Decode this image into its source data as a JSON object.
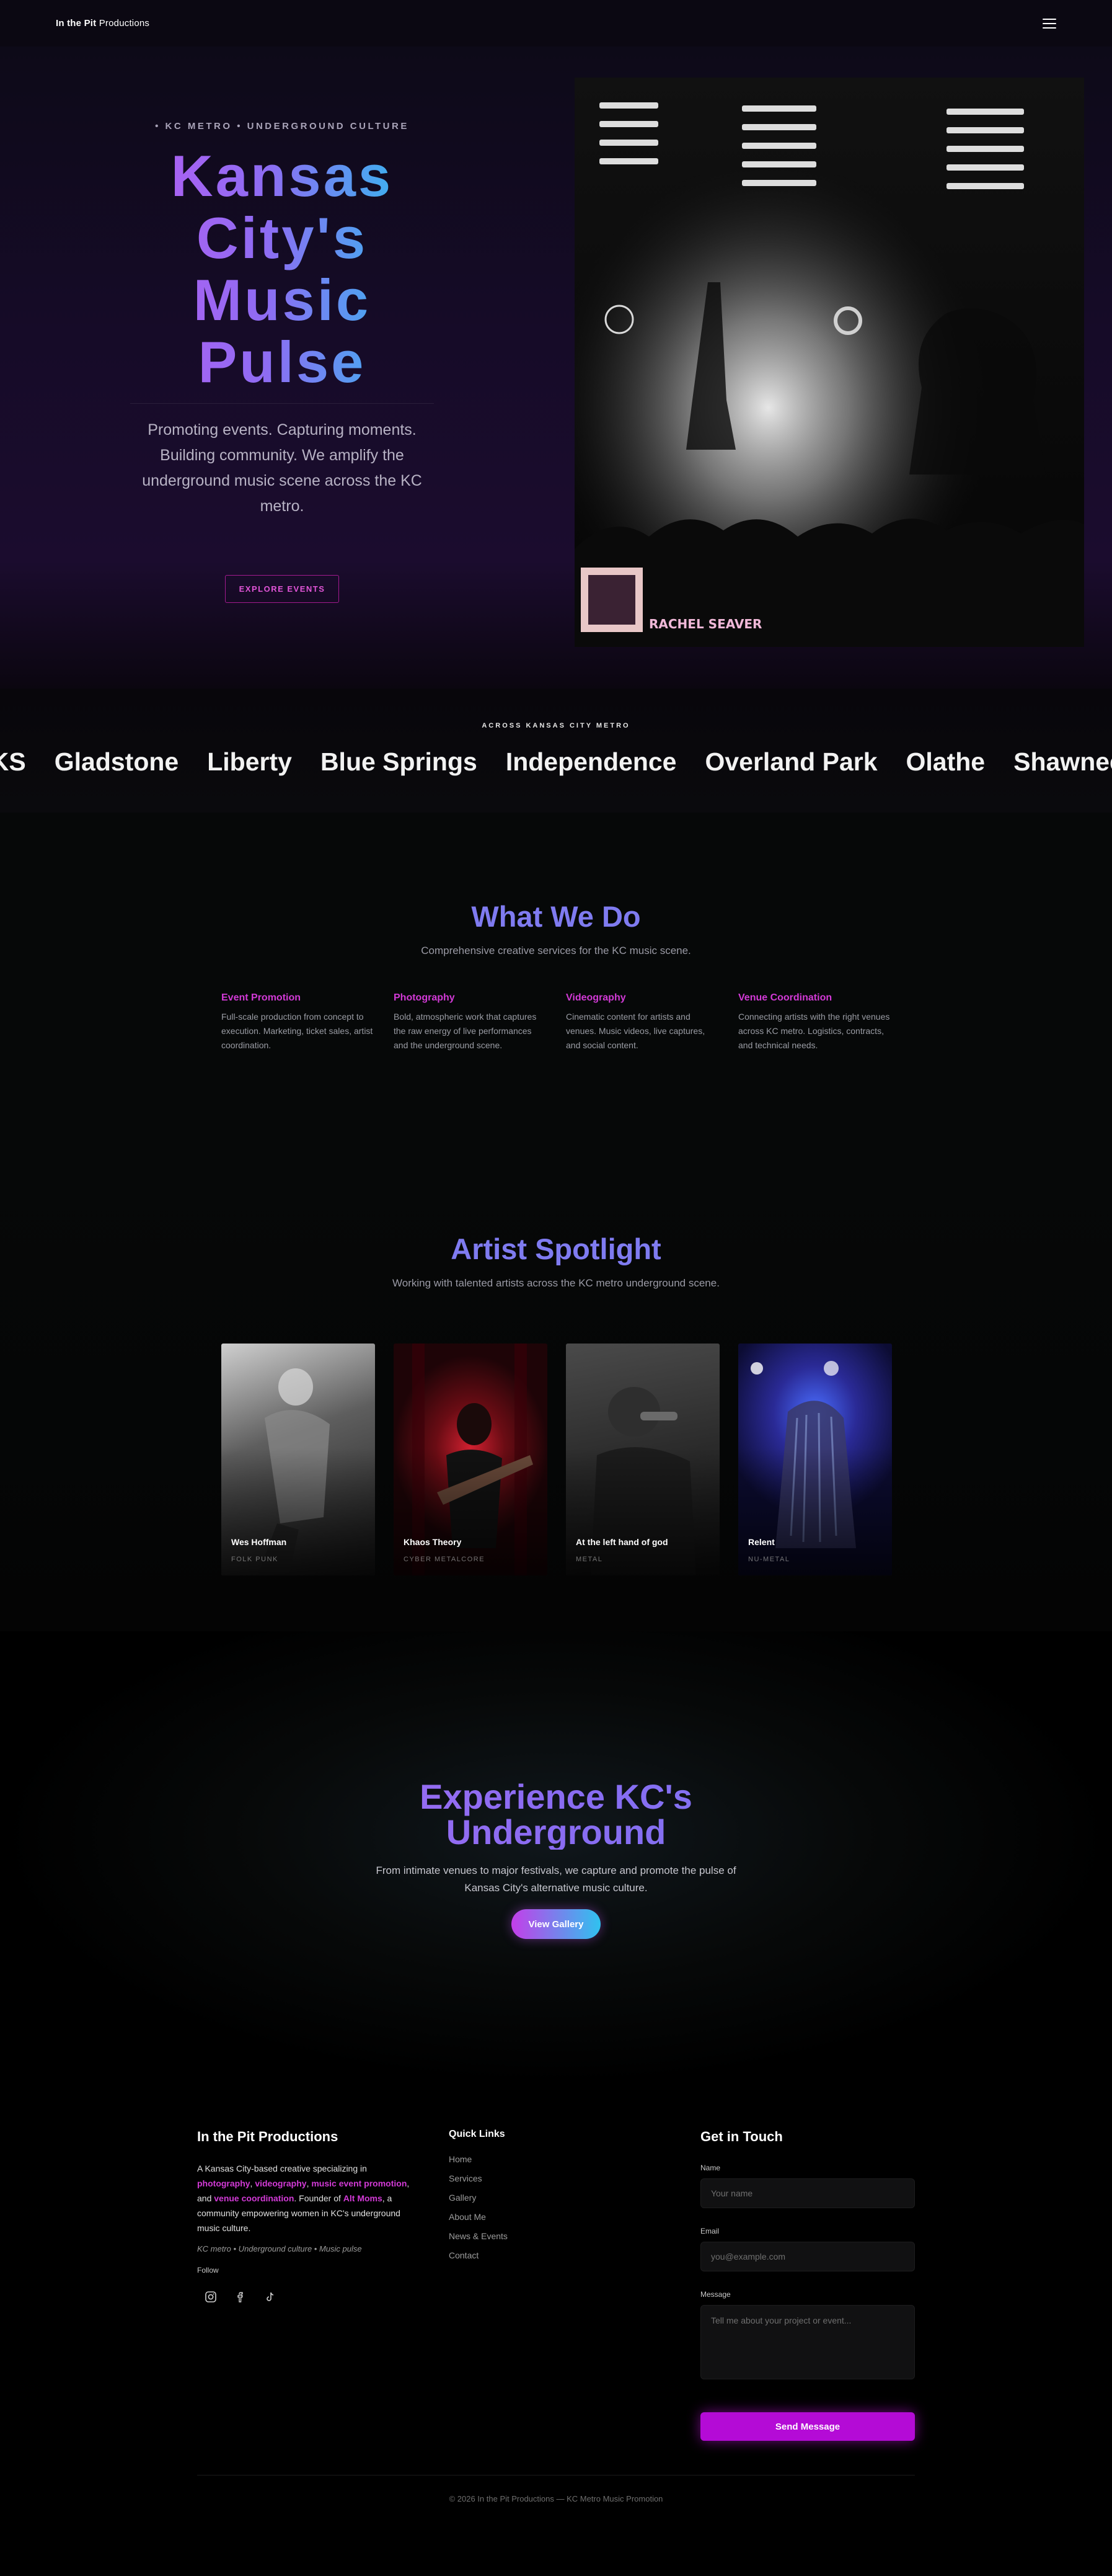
{
  "nav": {
    "brand_bold": "In the Pit",
    "brand_light": " Productions"
  },
  "hero": {
    "eyebrow": "• KC METRO • UNDERGROUND CULTURE",
    "title_lines": [
      "Kansas",
      "City's",
      "Music",
      "Pulse"
    ],
    "subtitle": "Promoting events. Capturing moments. Building community. We amplify the underground music scene across the KC metro.",
    "cta": "EXPLORE EVENTS",
    "photo_credit": "RACHEL SEAVER"
  },
  "cities": {
    "label": "ACROSS KANSAS CITY METRO",
    "items": [
      ", KS",
      "Gladstone",
      "Liberty",
      "Blue Springs",
      "Independence",
      "Overland Park",
      "Olathe",
      "Shawnee"
    ]
  },
  "services": {
    "title": "What We Do",
    "subtitle": "Comprehensive creative services for the KC music scene.",
    "items": [
      {
        "title": "Event Promotion",
        "text": "Full-scale production from concept to execution. Marketing, ticket sales, artist coordination."
      },
      {
        "title": "Photography",
        "text": "Bold, atmospheric work that captures the raw energy of live performances and the underground scene."
      },
      {
        "title": "Videography",
        "text": "Cinematic content for artists and venues. Music videos, live captures, and social content."
      },
      {
        "title": "Venue Coordination",
        "text": "Connecting artists with the right venues across KC metro. Logistics, contracts, and technical needs."
      }
    ]
  },
  "artists": {
    "title": "Artist Spotlight",
    "subtitle": "Working with talented artists across the KC metro underground scene.",
    "items": [
      {
        "name": "Wes Hoffman",
        "genre": "FOLK PUNK"
      },
      {
        "name": "Khaos Theory",
        "genre": "CYBER METALCORE"
      },
      {
        "name": "At the left hand of god",
        "genre": "METAL"
      },
      {
        "name": "Relent",
        "genre": "NU-METAL"
      }
    ]
  },
  "experience": {
    "title_line1": "Experience KC's",
    "title_line2": "Underground",
    "subtitle": "From intimate venues to major festivals, we capture and promote the pulse of Kansas City's alternative music culture.",
    "cta": "View Gallery"
  },
  "footer": {
    "brand": "In the Pit Productions",
    "about": {
      "p1": "A Kansas City-based creative specializing in ",
      "hl1": "photography",
      "p2": ", ",
      "hl2": "videography",
      "p3": ", ",
      "hl3": "music event promotion",
      "p4": ", and ",
      "hl4": "venue coordination",
      "p5": ". Founder of ",
      "hl5": "Alt Moms",
      "p6": ", a community empowering women in KC's underground music culture."
    },
    "tagline": "KC metro • Underground culture • Music pulse",
    "follow_label": "Follow",
    "social_icons": [
      "instagram-icon",
      "facebook-icon",
      "tiktok-icon"
    ],
    "quick_links_title": "Quick Links",
    "quick_links": [
      "Home",
      "Services",
      "Gallery",
      "About Me",
      "News & Events",
      "Contact"
    ],
    "contact": {
      "title": "Get in Touch",
      "name_label": "Name",
      "name_placeholder": "Your name",
      "email_label": "Email",
      "email_placeholder": "you@example.com",
      "message_label": "Message",
      "message_placeholder": "Tell me about your project or event...",
      "submit": "Send Message"
    },
    "copyright": "© 2026 In the Pit Productions — KC Metro Music Promotion"
  },
  "colors": {
    "accent_magenta": "#d23ad6",
    "accent_cyan": "#27c4ef",
    "accent_purple": "#8e6cf3",
    "send_button": "#b40bd6"
  }
}
